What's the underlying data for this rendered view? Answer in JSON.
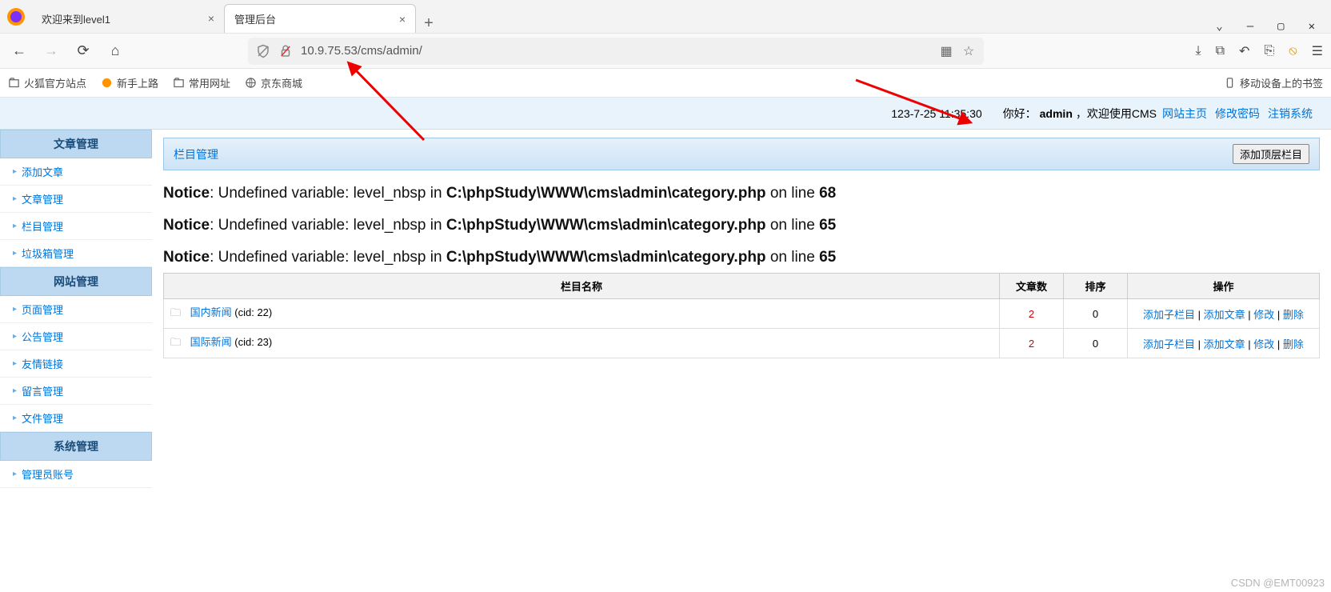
{
  "browser": {
    "tabs": [
      {
        "title": "欢迎来到level1",
        "active": false
      },
      {
        "title": "管理后台",
        "active": true
      }
    ],
    "url": "10.9.75.53/cms/admin/",
    "bookmarks": [
      {
        "label": "火狐官方站点",
        "type": "folder"
      },
      {
        "label": "新手上路",
        "type": "firefox"
      },
      {
        "label": "常用网址",
        "type": "folder"
      },
      {
        "label": "京东商城",
        "type": "globe"
      }
    ],
    "mobile_bk": "移动设备上的书签"
  },
  "header": {
    "datetime": "123-7-25 11:35:30",
    "hello_prefix": "你好：",
    "user": "admin",
    "welcome_suffix": "，欢迎使用CMS",
    "links": [
      "网站主页",
      "修改密码",
      "注销系统"
    ]
  },
  "sidebar": {
    "sections": [
      {
        "title": "文章管理",
        "items": [
          "添加文章",
          "文章管理",
          "栏目管理",
          "垃圾箱管理"
        ]
      },
      {
        "title": "网站管理",
        "items": [
          "页面管理",
          "公告管理",
          "友情链接",
          "留言管理",
          "文件管理"
        ]
      },
      {
        "title": "系统管理",
        "items": [
          "管理员账号"
        ]
      }
    ]
  },
  "panel": {
    "title": "栏目管理",
    "add_btn": "添加顶层栏目"
  },
  "notices": [
    {
      "bold1": "Notice",
      "mid": ": Undefined variable: level_nbsp in ",
      "bold2": "C:\\phpStudy\\WWW\\cms\\admin\\category.php",
      "tail": " on line ",
      "line": "68"
    },
    {
      "bold1": "Notice",
      "mid": ": Undefined variable: level_nbsp in ",
      "bold2": "C:\\phpStudy\\WWW\\cms\\admin\\category.php",
      "tail": " on line ",
      "line": "65"
    },
    {
      "bold1": "Notice",
      "mid": ": Undefined variable: level_nbsp in ",
      "bold2": "C:\\phpStudy\\WWW\\cms\\admin\\category.php",
      "tail": " on line ",
      "line": "65"
    }
  ],
  "table": {
    "headers": [
      "栏目名称",
      "文章数",
      "排序",
      "操作"
    ],
    "ops": [
      "添加子栏目",
      "添加文章",
      "修改",
      "删除"
    ],
    "rows": [
      {
        "name": "国内新闻",
        "cid": "(cid: 22)",
        "count": "2",
        "order": "0"
      },
      {
        "name": "国际新闻",
        "cid": "(cid: 23)",
        "count": "2",
        "order": "0"
      }
    ]
  },
  "watermark": "CSDN @EMT00923"
}
